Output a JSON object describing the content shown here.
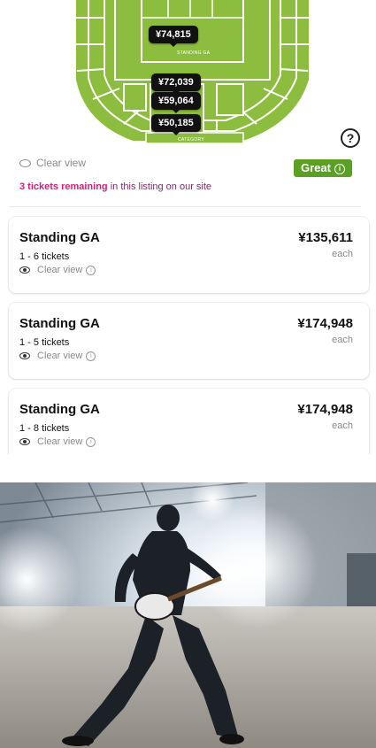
{
  "map": {
    "price_tags": [
      "¥74,815",
      "¥72,039",
      "¥59,064",
      "¥50,185"
    ],
    "labels": [
      "STANDING GA",
      "CATEGORY"
    ],
    "help_glyph": "?"
  },
  "partial_listing": {
    "view_text": "Clear view",
    "deal_label": "Great",
    "remaining_bold": "3 tickets remaining",
    "remaining_rest": " in this listing on our site"
  },
  "listings": [
    {
      "section": "Standing GA",
      "quantity": "1 - 6 tickets",
      "view": "Clear view",
      "price": "¥135,611",
      "unit": "each"
    },
    {
      "section": "Standing GA",
      "quantity": "1 - 5 tickets",
      "view": "Clear view",
      "price": "¥174,948",
      "unit": "each"
    },
    {
      "section": "Standing GA",
      "quantity": "1 - 8 tickets",
      "view": "Clear view",
      "price": "¥174,948",
      "unit": "each"
    }
  ],
  "colors": {
    "map_green": "#8dbd3f",
    "deal_green": "#5aa025",
    "remaining_pink": "#d31f7a"
  },
  "photo": {
    "subject": "guitarist-performing-image"
  }
}
